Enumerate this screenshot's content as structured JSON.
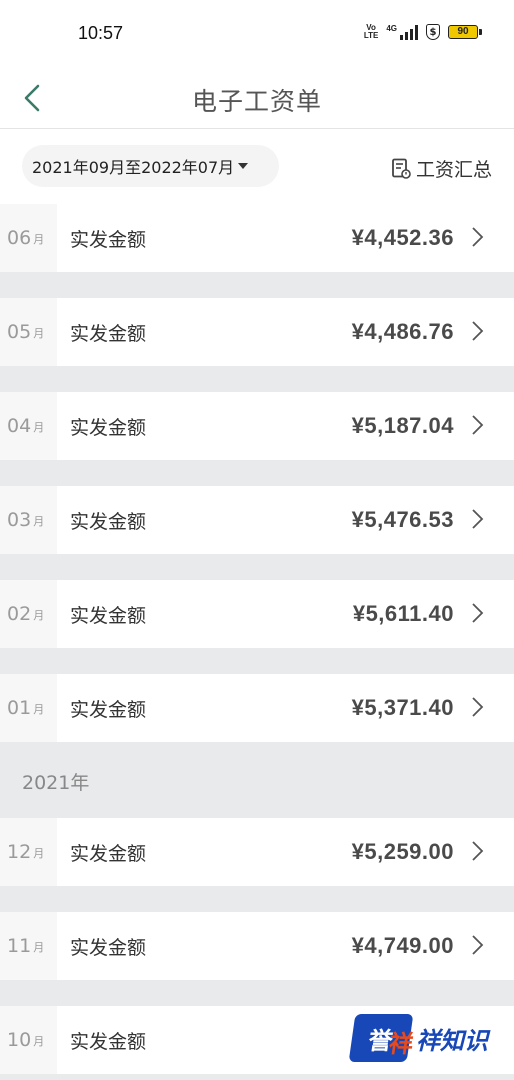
{
  "status_bar": {
    "time": "10:57",
    "volte_line1": "Vo",
    "volte_line2": "LTE",
    "network": "4G",
    "battery": "90",
    "shield_symbol": "$"
  },
  "nav": {
    "title": "电子工资单",
    "back_icon": "chevron-left-icon"
  },
  "filter": {
    "date_range": "2021年09月至2022年07月",
    "summary_label": "工资汇总",
    "summary_icon": "report-icon"
  },
  "rows_2022": [
    {
      "month": "06",
      "suffix": "月",
      "label": "实发金额",
      "amount": "¥4,452.36"
    },
    {
      "month": "05",
      "suffix": "月",
      "label": "实发金额",
      "amount": "¥4,486.76"
    },
    {
      "month": "04",
      "suffix": "月",
      "label": "实发金额",
      "amount": "¥5,187.04"
    },
    {
      "month": "03",
      "suffix": "月",
      "label": "实发金额",
      "amount": "¥5,476.53"
    },
    {
      "month": "02",
      "suffix": "月",
      "label": "实发金额",
      "amount": "¥5,611.40"
    },
    {
      "month": "01",
      "suffix": "月",
      "label": "实发金额",
      "amount": "¥5,371.40"
    }
  ],
  "year_header": "2021年",
  "rows_2021": [
    {
      "month": "12",
      "suffix": "月",
      "label": "实发金额",
      "amount": "¥5,259.00"
    },
    {
      "month": "11",
      "suffix": "月",
      "label": "实发金额",
      "amount": "¥4,749.00"
    },
    {
      "month": "10",
      "suffix": "月",
      "label": "实发金额",
      "amount": ""
    }
  ],
  "watermark": {
    "logo_char1": "誉",
    "logo_char2": "祥",
    "text": "祥知识"
  },
  "colors": {
    "background": "#e9eaeb",
    "card": "#ffffff",
    "month_cell": "#f7f7f7",
    "back_icon": "#3a7a68",
    "watermark_blue": "#1848b8",
    "watermark_orange": "#e84a1b"
  }
}
